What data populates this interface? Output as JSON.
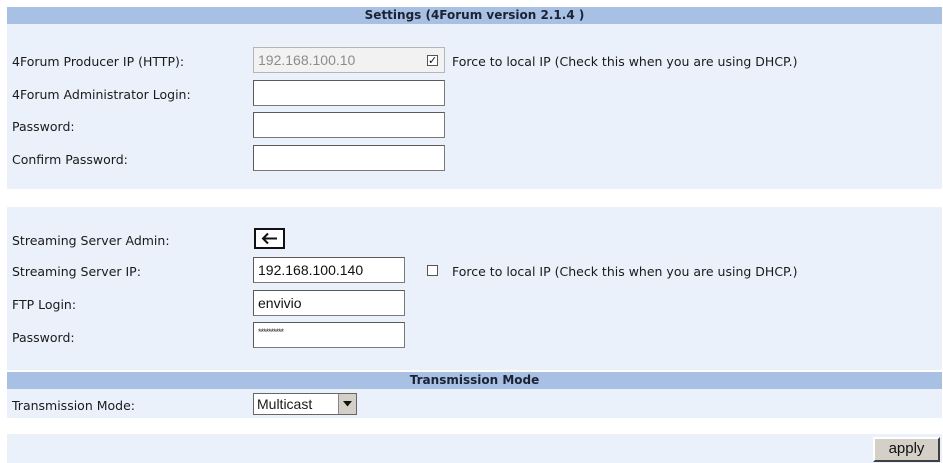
{
  "settings_header": "Settings (4Forum version 2.1.4 )",
  "producer": {
    "ip_label": "4Forum Producer IP (HTTP):",
    "ip_value": "192.168.100.10",
    "force_local_checked": true,
    "force_local_label": "Force to local IP (Check this when you are using DHCP.)",
    "admin_login_label": "4Forum Administrator Login:",
    "admin_login_value": "",
    "password_label": "Password:",
    "password_value": "",
    "confirm_password_label": "Confirm Password:",
    "confirm_password_value": ""
  },
  "streaming": {
    "admin_label": "Streaming Server Admin:",
    "admin_icon": "arrow-left-icon",
    "ip_label": "Streaming Server IP:",
    "ip_value": "192.168.100.140",
    "force_local_checked": false,
    "force_local_label": "Force to local IP (Check this when you are using DHCP.)",
    "ftp_login_label": "FTP Login:",
    "ftp_login_value": "envivio",
    "password_label": "Password:",
    "password_mask": "**********"
  },
  "transmission_header": "Transmission Mode",
  "transmission": {
    "mode_label": "Transmission Mode:",
    "mode_value": "Multicast"
  },
  "apply_label": "apply",
  "colors": {
    "header_bg": "#a8c0e4",
    "panel_bg": "#eaf1fb"
  }
}
